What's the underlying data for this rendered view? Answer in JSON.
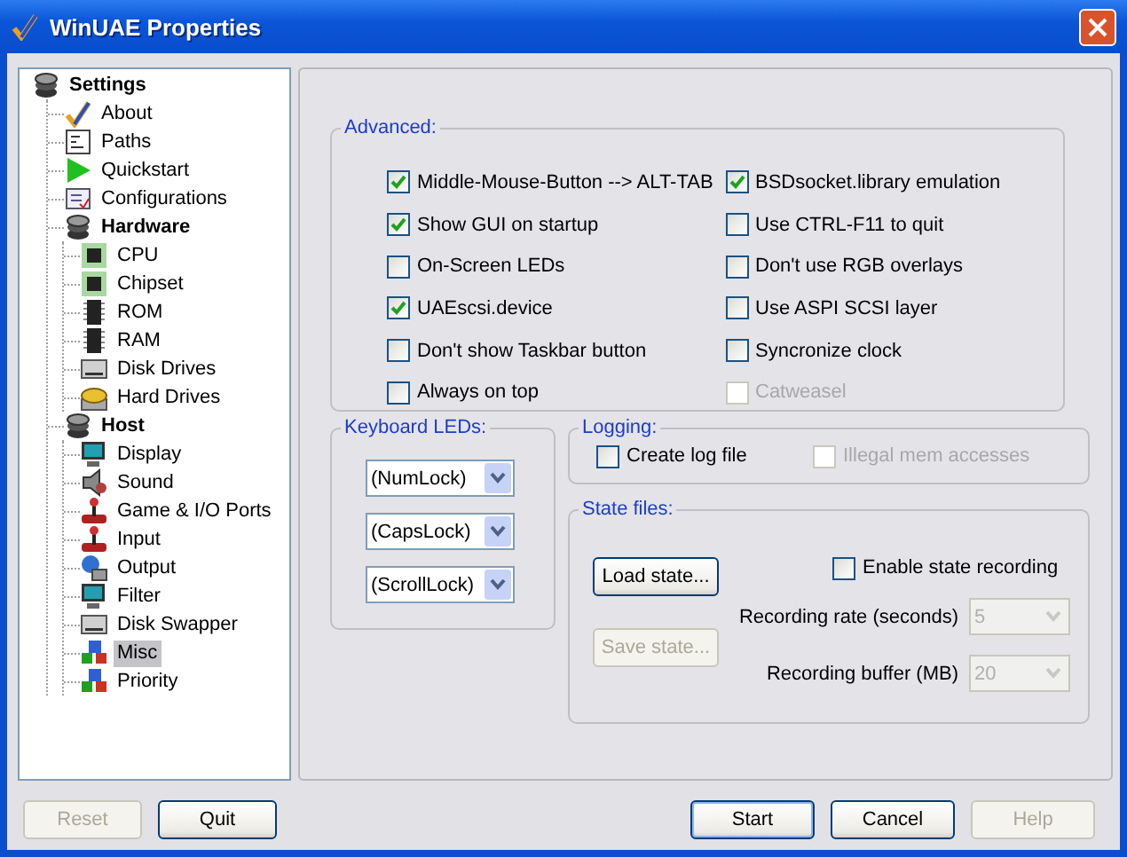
{
  "window": {
    "title": "WinUAE Properties"
  },
  "tree": [
    {
      "label": "Settings",
      "kind": "group",
      "selected": false,
      "children": [
        {
          "label": "About",
          "kind": "check",
          "selected": false
        },
        {
          "label": "Paths",
          "kind": "paths",
          "selected": false
        },
        {
          "label": "Quickstart",
          "kind": "play",
          "selected": false
        },
        {
          "label": "Configurations",
          "kind": "config",
          "selected": false
        },
        {
          "label": "Hardware",
          "kind": "group",
          "selected": false,
          "children": [
            {
              "label": "CPU",
              "kind": "chip",
              "selected": false
            },
            {
              "label": "Chipset",
              "kind": "chip",
              "selected": false
            },
            {
              "label": "ROM",
              "kind": "memory",
              "selected": false
            },
            {
              "label": "RAM",
              "kind": "memory",
              "selected": false
            },
            {
              "label": "Disk Drives",
              "kind": "drive",
              "selected": false
            },
            {
              "label": "Hard Drives",
              "kind": "harddrive",
              "selected": false
            }
          ]
        },
        {
          "label": "Host",
          "kind": "group",
          "selected": false,
          "children": [
            {
              "label": "Display",
              "kind": "monitor",
              "selected": false
            },
            {
              "label": "Sound",
              "kind": "sound",
              "selected": false
            },
            {
              "label": "Game & I/O Ports",
              "kind": "joystick",
              "selected": false
            },
            {
              "label": "Input",
              "kind": "joystick",
              "selected": false
            },
            {
              "label": "Output",
              "kind": "output",
              "selected": false
            },
            {
              "label": "Filter",
              "kind": "monitor",
              "selected": false
            },
            {
              "label": "Disk Swapper",
              "kind": "drive",
              "selected": false
            },
            {
              "label": "Misc",
              "kind": "shapes",
              "selected": true
            },
            {
              "label": "Priority",
              "kind": "shapes",
              "selected": false
            }
          ]
        }
      ]
    }
  ],
  "advanced": {
    "title": "Advanced:",
    "columns": [
      {
        "options": [
          {
            "label": "Middle-Mouse-Button --> ALT-TAB",
            "checked": true,
            "disabled": false
          },
          {
            "label": "Show GUI on startup",
            "checked": true,
            "disabled": false
          },
          {
            "label": "On-Screen LEDs",
            "checked": false,
            "disabled": false
          },
          {
            "label": "UAEscsi.device",
            "checked": true,
            "disabled": false
          },
          {
            "label": "Don't show Taskbar button",
            "checked": false,
            "disabled": false
          },
          {
            "label": "Always on top",
            "checked": false,
            "disabled": false
          }
        ]
      },
      {
        "options": [
          {
            "label": "BSDsocket.library emulation",
            "checked": true,
            "disabled": false
          },
          {
            "label": "Use CTRL-F11 to quit",
            "checked": false,
            "disabled": false
          },
          {
            "label": "Don't use RGB overlays",
            "checked": false,
            "disabled": false
          },
          {
            "label": "Use ASPI SCSI layer",
            "checked": false,
            "disabled": false
          },
          {
            "label": "Syncronize clock",
            "checked": false,
            "disabled": false
          },
          {
            "label": "Catweasel",
            "checked": false,
            "disabled": true
          }
        ]
      }
    ]
  },
  "keyboard_leds": {
    "title": "Keyboard LEDs:",
    "dropdowns": [
      {
        "value": "(NumLock)"
      },
      {
        "value": "(CapsLock)"
      },
      {
        "value": "(ScrollLock)"
      }
    ]
  },
  "logging": {
    "title": "Logging:",
    "options": [
      {
        "label": "Create log file",
        "checked": false,
        "disabled": false
      },
      {
        "label": "Illegal mem accesses",
        "checked": false,
        "disabled": true
      }
    ]
  },
  "state_files": {
    "title": "State files:",
    "buttons": [
      {
        "label": "Load state...",
        "disabled": false
      },
      {
        "label": "Save state...",
        "disabled": true
      }
    ],
    "recording": {
      "label": "Enable state recording",
      "checked": false,
      "disabled": false
    },
    "fields": [
      {
        "label": "Recording rate (seconds)",
        "value": "5",
        "disabled": true
      },
      {
        "label": "Recording buffer (MB)",
        "value": "20",
        "disabled": true
      }
    ]
  },
  "buttons": [
    {
      "label": "Reset",
      "disabled": true,
      "default": false
    },
    {
      "label": "Quit",
      "disabled": false,
      "default": false
    },
    {
      "label": "Start",
      "disabled": false,
      "default": true
    },
    {
      "label": "Cancel",
      "disabled": false,
      "default": false
    },
    {
      "label": "Help",
      "disabled": true,
      "default": false
    }
  ]
}
